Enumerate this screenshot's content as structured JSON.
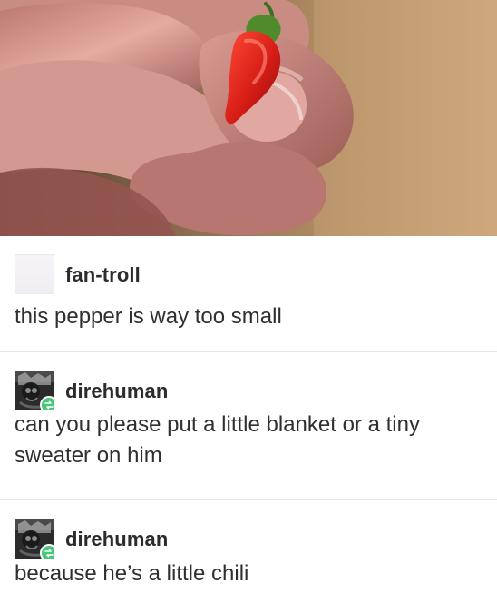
{
  "photo": {
    "subject_icon": "chili-pepper-icon",
    "hand_icon": "hand-icon"
  },
  "posts": [
    {
      "username": "fan-troll",
      "message": "this pepper is way too small",
      "avatar_icon": "default-avatar-icon"
    },
    {
      "username": "direhuman",
      "message": "can you please put a little blanket or a tiny sweater on him",
      "avatar_icon": "user-avatar-icon",
      "badge_icon": "reblog-icon"
    },
    {
      "username": "direhuman",
      "message": "because he’s a little chili",
      "avatar_icon": "user-avatar-icon",
      "badge_icon": "reblog-icon"
    }
  ],
  "colors": {
    "text": "#2f2f2f",
    "divider": "#e7e7e7",
    "reblog_badge": "#48c77b",
    "pepper_red": "#d71d17",
    "pepper_stem": "#4f8b2d"
  }
}
